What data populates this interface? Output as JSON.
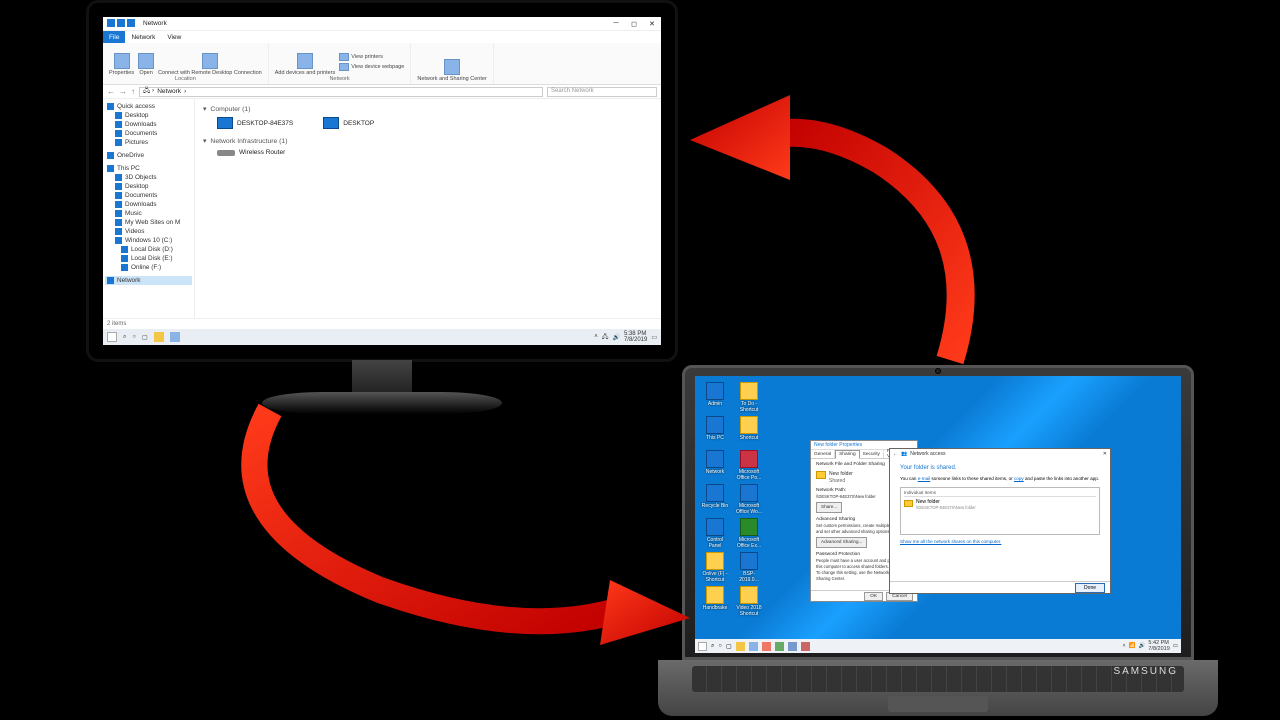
{
  "monitor": {
    "window": {
      "title": "Network",
      "tabs": {
        "file": "File",
        "network": "Network",
        "view": "View"
      },
      "ribbon": {
        "properties": "Properties",
        "open": "Open",
        "remote": "Connect with Remote\nDesktop Connection",
        "location_group": "Location",
        "add_devices": "Add devices\nand printers",
        "view_printers": "View printers",
        "view_webpage": "View device webpage",
        "network_group": "Network",
        "sharing_center": "Network and\nSharing Center"
      },
      "address": {
        "root": "Network"
      },
      "search_placeholder": "Search Network",
      "nav": {
        "quick": "Quick access",
        "desktop": "Desktop",
        "downloads": "Downloads",
        "documents": "Documents",
        "pictures": "Pictures",
        "onedrive": "OneDrive",
        "thispc": "This PC",
        "objects3d": "3D Objects",
        "desktop2": "Desktop",
        "documents2": "Documents",
        "downloads2": "Downloads",
        "music": "Music",
        "mywebsites": "My Web Sites on M",
        "videos": "Videos",
        "windows10": "Windows 10 (C:)",
        "localD": "Local Disk (D:)",
        "localE": "Local Disk (E:)",
        "onlineF": "Online (F:)",
        "network": "Network"
      },
      "groups": {
        "computer": "Computer (1)",
        "infra": "Network Infrastructure (1)"
      },
      "items": {
        "pc1": "DESKTOP-84E37S",
        "pc2": "DESKTOP",
        "router": "Wireless Router"
      },
      "status": "2 items"
    },
    "taskbar": {
      "time": "5:38 PM",
      "date": "7/8/2019"
    }
  },
  "laptop": {
    "brand": "SAMSUNG",
    "desktop_icons": [
      {
        "label": "Admin",
        "cls": "blue"
      },
      {
        "label": "To Do - Shortcut",
        "cls": ""
      },
      {
        "label": "This PC",
        "cls": "blue"
      },
      {
        "label": "Shortcut",
        "cls": ""
      },
      {
        "label": "Network",
        "cls": "blue"
      },
      {
        "label": "Microsoft Office Po...",
        "cls": "red"
      },
      {
        "label": "Recycle Bin",
        "cls": "blue"
      },
      {
        "label": "Microsoft Office Wo...",
        "cls": "blue"
      },
      {
        "label": "Control Panel",
        "cls": "blue"
      },
      {
        "label": "Microsoft Office Ex...",
        "cls": "green"
      },
      {
        "label": "Onlive (F) - Shortcut",
        "cls": ""
      },
      {
        "label": "BSP-2019.0...",
        "cls": "blue"
      },
      {
        "label": "Handbrake",
        "cls": ""
      },
      {
        "label": "Video 2018 Shortcut",
        "cls": ""
      }
    ],
    "properties": {
      "title": "New folder Properties",
      "tabs": {
        "general": "General",
        "sharing": "Sharing",
        "security": "Security",
        "prev": "Previous Vers"
      },
      "sec1": "Network File and Folder Sharing",
      "folder": "New folder",
      "state": "Shared",
      "path_label": "Network Path:",
      "path": "\\\\DESKTOP-84E37S\\New folder",
      "share_btn": "Share...",
      "adv_label": "Advanced Sharing",
      "adv_text": "Set custom permissions, create multiple shares, and set other advanced sharing options.",
      "adv_btn": "Advanced Sharing...",
      "pwd_label": "Password Protection",
      "pwd_text": "People must have a user account and password for this computer to access shared folders.",
      "pwd_link": "To change this setting, use the Network and Sharing Center.",
      "ok": "OK",
      "cancel": "Cancel"
    },
    "share": {
      "title": "Network access",
      "header": "Your folder is shared.",
      "hint_pre": "You can ",
      "hint_link1": "e-mail",
      "hint_mid": " someone links to these shared items, or ",
      "hint_link2": "copy",
      "hint_post": " and paste the links into another app.",
      "col": "Individual Items",
      "item_name": "New folder",
      "item_path": "\\\\DESKTOP-84E37S\\New folder",
      "foot_link": "Show me all the network shares on this computer.",
      "done": "Done"
    },
    "taskbar": {
      "time": "5:42 PM",
      "date": "7/8/2019"
    }
  }
}
